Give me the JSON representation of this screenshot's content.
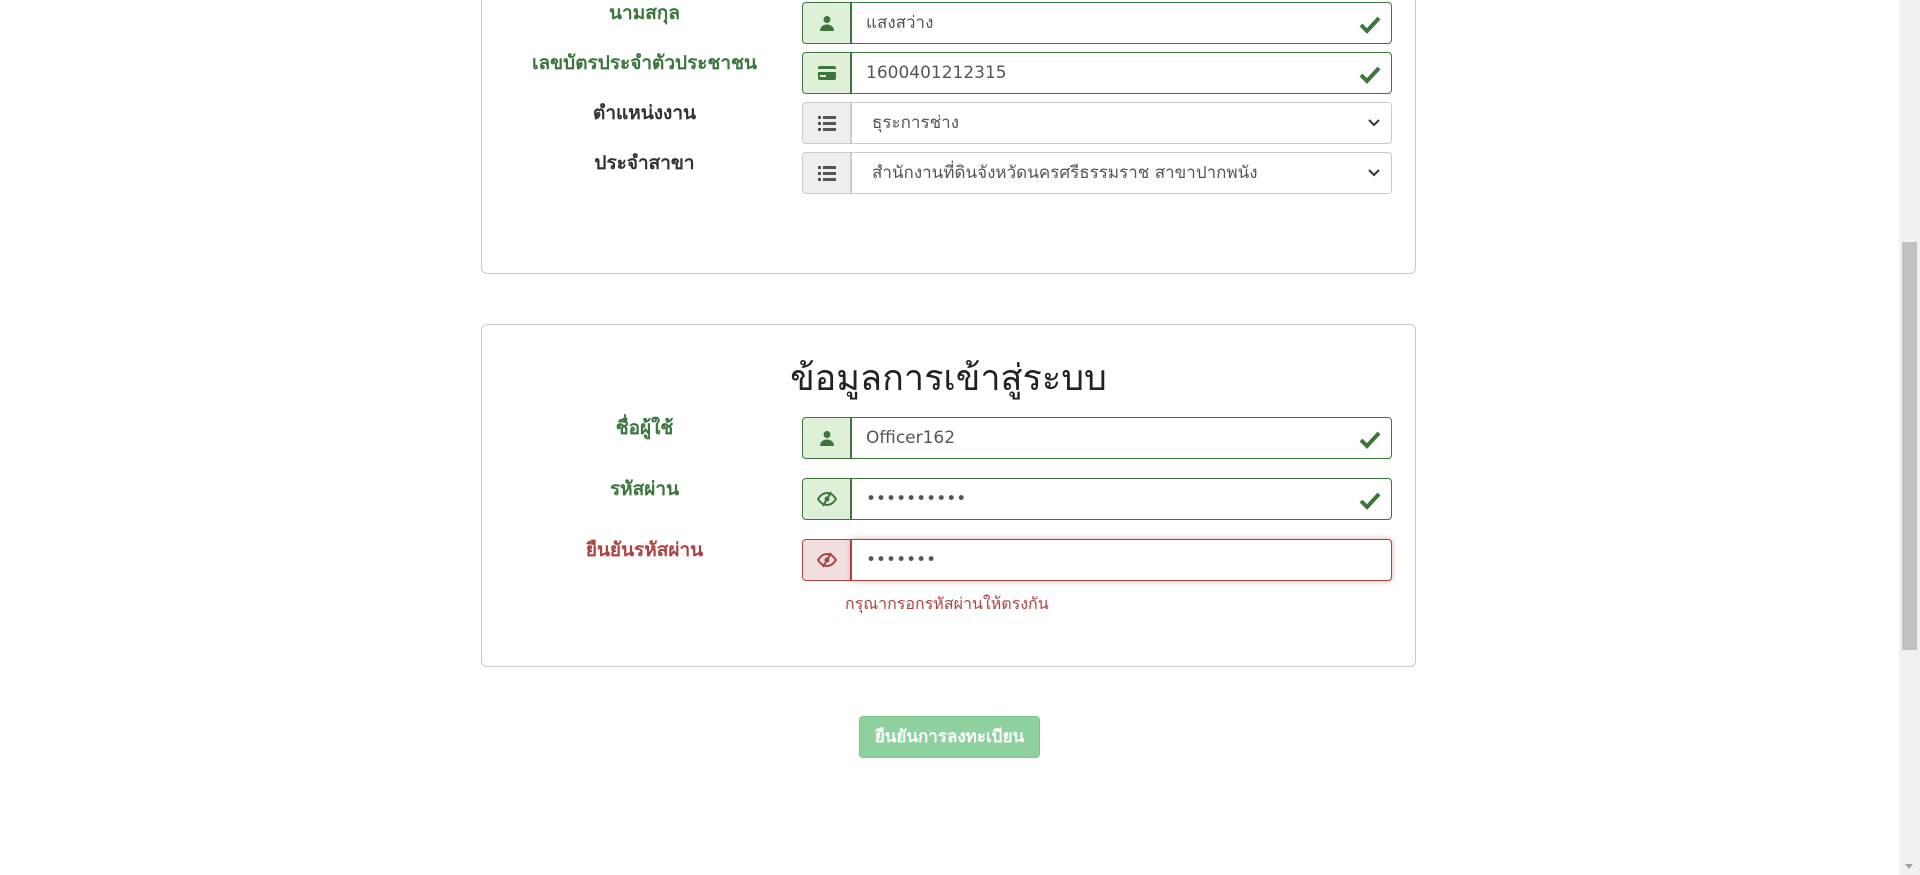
{
  "personal_section": {
    "rows": [
      {
        "label": "นามสกุล",
        "value": "แสงสว่าง",
        "icon": "user-icon",
        "state": "valid"
      },
      {
        "label": "เลขบัตรประจำตัวประชาชน",
        "value": "1600401212315",
        "icon": "id-card-icon",
        "state": "valid"
      },
      {
        "label": "ตำแหน่งงาน",
        "value": "ธุระการช่าง",
        "icon": "list-icon",
        "state": "select"
      },
      {
        "label": "ประจำสาขา",
        "value": "สำนักงานที่ดินจังหวัดนครศรีธรรมราช สาขาปากพนัง",
        "icon": "list-icon",
        "state": "select"
      }
    ]
  },
  "login_section": {
    "title": "ข้อมูลการเข้าสู่ระบบ",
    "username": {
      "label": "ชื่อผู้ใช้",
      "value": "Officer162",
      "icon": "user-icon",
      "state": "valid"
    },
    "password": {
      "label": "รหัสผ่าน",
      "value": "••••••••••",
      "icon": "eye-slash-icon",
      "state": "valid"
    },
    "confirm_password": {
      "label": "ยืนยันรหัสผ่าน",
      "value": "•••••••",
      "icon": "eye-slash-icon",
      "state": "error"
    },
    "error_message": "กรุณากรอกรหัสผ่านให้ตรงกัน"
  },
  "submit": {
    "label": "ยืนยันการลงทะเบียน"
  },
  "colors": {
    "success": "#3c763d",
    "success_bg": "#dff0d8",
    "error": "#a94442",
    "error_bg": "#f2dede",
    "button": "#8fd19e"
  }
}
